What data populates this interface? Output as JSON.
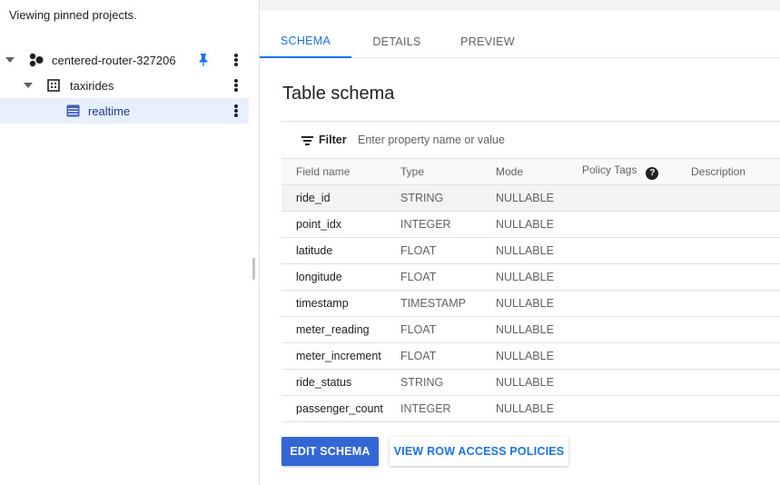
{
  "sidebar": {
    "pinned_message": "Viewing pinned projects.",
    "tree": [
      {
        "label": "centered-router-327206",
        "icon": "project-icon",
        "pinned": true
      },
      {
        "label": "taxirides",
        "icon": "dataset-icon"
      },
      {
        "label": "realtime",
        "icon": "table-icon",
        "selected": true
      }
    ]
  },
  "tabs": [
    {
      "label": "SCHEMA",
      "active": true
    },
    {
      "label": "DETAILS"
    },
    {
      "label": "PREVIEW"
    }
  ],
  "schema": {
    "title": "Table schema",
    "filter": {
      "label": "Filter",
      "placeholder": "Enter property name or value"
    },
    "columns": [
      "Field name",
      "Type",
      "Mode",
      "Policy Tags",
      "Description"
    ],
    "rows": [
      {
        "name": "ride_id",
        "type": "STRING",
        "mode": "NULLABLE"
      },
      {
        "name": "point_idx",
        "type": "INTEGER",
        "mode": "NULLABLE"
      },
      {
        "name": "latitude",
        "type": "FLOAT",
        "mode": "NULLABLE"
      },
      {
        "name": "longitude",
        "type": "FLOAT",
        "mode": "NULLABLE"
      },
      {
        "name": "timestamp",
        "type": "TIMESTAMP",
        "mode": "NULLABLE"
      },
      {
        "name": "meter_reading",
        "type": "FLOAT",
        "mode": "NULLABLE"
      },
      {
        "name": "meter_increment",
        "type": "FLOAT",
        "mode": "NULLABLE"
      },
      {
        "name": "ride_status",
        "type": "STRING",
        "mode": "NULLABLE"
      },
      {
        "name": "passenger_count",
        "type": "INTEGER",
        "mode": "NULLABLE"
      }
    ]
  },
  "actions": {
    "edit_schema": "EDIT SCHEMA",
    "view_row_access": "VIEW ROW ACCESS POLICIES"
  },
  "colors": {
    "accent": "#1a73e8",
    "primary_button": "#3367d6",
    "selected_row": "#e8f0fe"
  }
}
